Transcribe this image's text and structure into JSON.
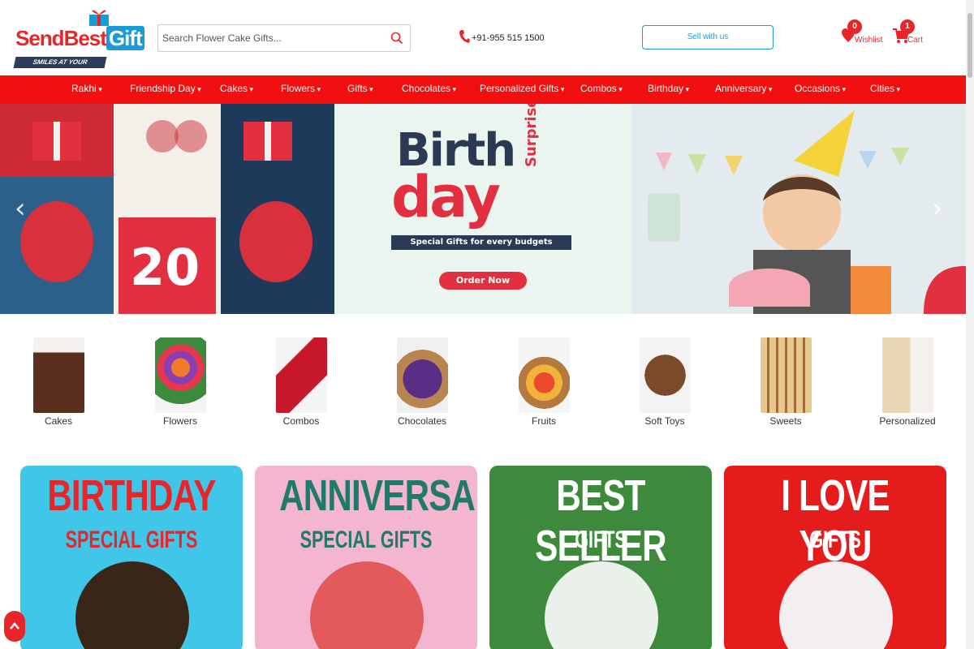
{
  "header": {
    "logo_send": "SendBest",
    "logo_gift": "Gift",
    "logo_tagline": "SMILES AT YOUR DOORSTEP",
    "search_placeholder": "Search Flower Cake Gifts...",
    "phone": "+91-955 515 1500",
    "sell_label": "Sell with us",
    "wishlist_label": "Wishlist",
    "wishlist_count": "0",
    "cart_label": "Cart",
    "cart_count": "1"
  },
  "nav": {
    "items": [
      {
        "label": "Rakhi"
      },
      {
        "label": "Friendship Day"
      },
      {
        "label": "Cakes"
      },
      {
        "label": "Flowers"
      },
      {
        "label": "Gifts"
      },
      {
        "label": "Chocolates"
      },
      {
        "label": "Personalized Gifts"
      },
      {
        "label": "Combos"
      },
      {
        "label": "Birthday"
      },
      {
        "label": "Anniversary"
      },
      {
        "label": "Occasions"
      },
      {
        "label": "Cities"
      }
    ]
  },
  "banner": {
    "title_line1": "Birth",
    "title_line2": "day",
    "title_side": "Surprises",
    "subtitle": "Special Gifts for every budgets",
    "cta": "Order Now",
    "calendar_number": "20"
  },
  "categories": [
    {
      "label": "Cakes"
    },
    {
      "label": "Flowers"
    },
    {
      "label": "Combos"
    },
    {
      "label": "Chocolates"
    },
    {
      "label": "Fruits"
    },
    {
      "label": "Soft Toys"
    },
    {
      "label": "Sweets"
    },
    {
      "label": "Personalized"
    }
  ],
  "promos": [
    {
      "big": "BIRTHDAY",
      "small": "SPECIAL GIFTS"
    },
    {
      "big": "ANNIVERSARY",
      "small": "SPECIAL GIFTS"
    },
    {
      "big": "BEST SELLER",
      "small": "GIFTS"
    },
    {
      "big": "I LOVE YOU",
      "small": "GIFTS"
    }
  ],
  "colors": {
    "brand_red": "#f20f0f",
    "brand_blue": "#1a9bd7"
  }
}
